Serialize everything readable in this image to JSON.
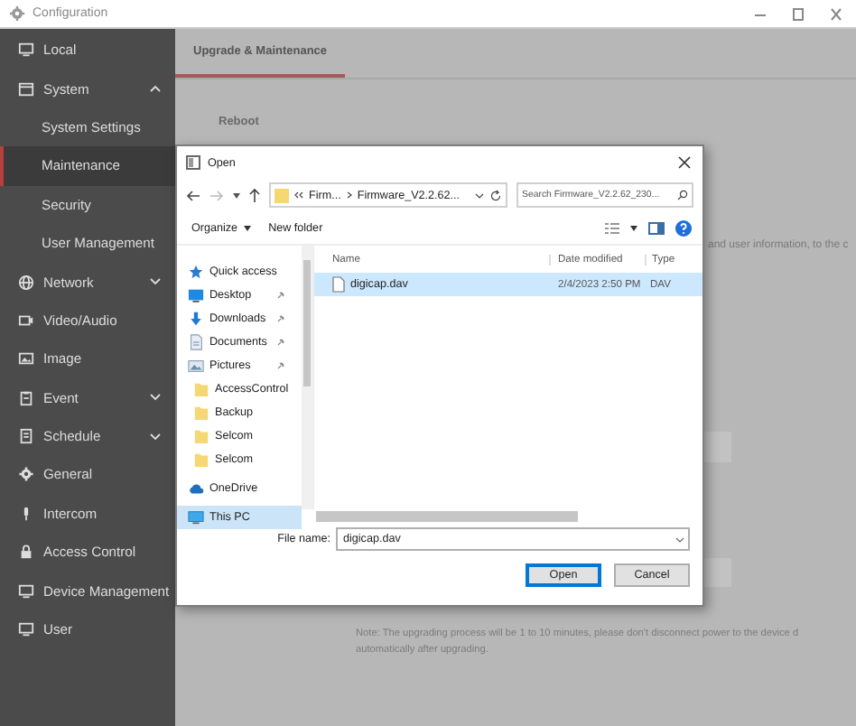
{
  "window": {
    "title": "Configuration"
  },
  "sidebar": {
    "items": [
      {
        "label": "Local",
        "kind": "monitor",
        "selected": false
      },
      {
        "label": "System",
        "kind": "window",
        "selected": false,
        "expanded": true,
        "children": [
          {
            "label": "System Settings",
            "selected": false
          },
          {
            "label": "Maintenance",
            "selected": true
          },
          {
            "label": "Security",
            "selected": false
          },
          {
            "label": "User Management",
            "selected": false
          }
        ]
      },
      {
        "label": "Network",
        "kind": "globe",
        "selected": false,
        "expanded": false
      },
      {
        "label": "Video/Audio",
        "kind": "camera",
        "selected": false
      },
      {
        "label": "Image",
        "kind": "image",
        "selected": false
      },
      {
        "label": "Event",
        "kind": "clipboard",
        "selected": false,
        "expanded": false
      },
      {
        "label": "Schedule",
        "kind": "list",
        "selected": false,
        "expanded": false
      },
      {
        "label": "General",
        "kind": "gear",
        "selected": false
      },
      {
        "label": "Intercom",
        "kind": "mic",
        "selected": false
      },
      {
        "label": "Access Control",
        "kind": "lock",
        "selected": false
      },
      {
        "label": "Device Management",
        "kind": "monitor",
        "selected": false
      },
      {
        "label": "User",
        "kind": "monitor",
        "selected": false
      }
    ]
  },
  "tabs": [
    {
      "label": "Upgrade & Maintenance",
      "selected": true
    }
  ],
  "page": {
    "section": "Reboot",
    "partial_text": "and user information, to the c",
    "note_lines": [
      "Note: The upgrading process will be 1 to 10 minutes, please don't disconnect power to the device d",
      "automatically after upgrading."
    ]
  },
  "dialog": {
    "title": "Open",
    "path": [
      "Firm...",
      "Firmware_V2.2.62..."
    ],
    "search": {
      "placeholder": "Search Firmware_V2.2.62_230..."
    },
    "toolbar": [
      "Organize",
      "New folder"
    ],
    "nav": [
      {
        "label": "Quick access",
        "kind": "star",
        "pinned": false,
        "selected": false
      },
      {
        "label": "Desktop",
        "kind": "desktop",
        "pinned": true,
        "selected": false
      },
      {
        "label": "Downloads",
        "kind": "download",
        "pinned": true,
        "selected": false
      },
      {
        "label": "Documents",
        "kind": "document",
        "pinned": true,
        "selected": false
      },
      {
        "label": "Pictures",
        "kind": "pictures",
        "pinned": true,
        "selected": false
      },
      {
        "label": "AccessControl",
        "kind": "folder",
        "pinned": false,
        "selected": false
      },
      {
        "label": "Backup",
        "kind": "folder",
        "pinned": false,
        "selected": false
      },
      {
        "label": "Selcom",
        "kind": "folder",
        "pinned": false,
        "selected": false
      },
      {
        "label": "Selcom",
        "kind": "folder",
        "pinned": false,
        "selected": false
      },
      {
        "label": "OneDrive",
        "kind": "cloud",
        "pinned": false,
        "selected": false
      },
      {
        "label": "This PC",
        "kind": "pc",
        "pinned": false,
        "selected": true
      }
    ],
    "columns": [
      "Name",
      "Date modified",
      "Type"
    ],
    "files": [
      {
        "name": "digicap.dav",
        "date": "2/4/2023 2:50 PM",
        "type": "DAV",
        "selected": true
      }
    ],
    "file_name": {
      "label": "File name:",
      "value": "digicap.dav"
    },
    "buttons": [
      {
        "label": "Open",
        "default": true
      },
      {
        "label": "Cancel",
        "default": false
      }
    ]
  }
}
